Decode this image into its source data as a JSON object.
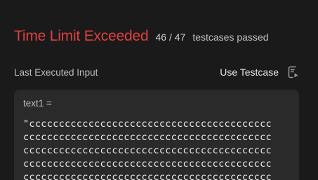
{
  "result": {
    "status": "Time Limit Exceeded",
    "count": "46 / 47",
    "count_label": "testcases passed"
  },
  "input": {
    "header": "Last Executed Input",
    "use_testcase_label": "Use Testcase",
    "use_testcase_icon": "use-testcase-icon",
    "variable": "text1 =",
    "value": "\"ccccccccccccccccccccccccccccccccccccccccc\ncccccccccccccccccccccccccccccccccccccccccc\ncccccccccccccccccccccccccccccccccccccccccc\ncccccccccccccccccccccccccccccccccccccccccc\ncccccccccccccccccccccccccccccccccccccccccc"
  },
  "colors": {
    "status": "#e03f3f",
    "background": "#1a1a1a",
    "box": "#2a2a2a"
  }
}
